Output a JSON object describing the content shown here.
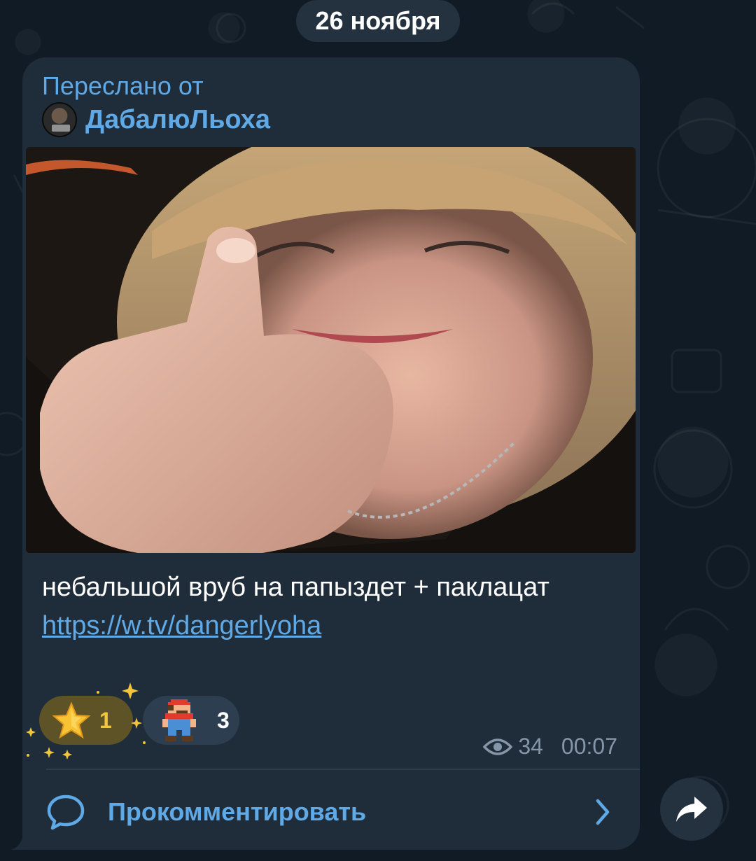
{
  "date_separator": "26 ноября",
  "message": {
    "forwarded_label": "Переслано от",
    "forwarded_author": "ДабалюЛьоха",
    "caption_text": "небальшой вруб на папыздет + паклацат",
    "caption_link": "https://w.tv/dangerlyoha",
    "reactions": [
      {
        "emoji": "star-icon",
        "count": "1"
      },
      {
        "emoji": "mario-icon",
        "count": "3"
      }
    ],
    "views": "34",
    "time": "00:07"
  },
  "comments": {
    "label": "Прокомментировать"
  },
  "colors": {
    "accent": "#5fa9e6",
    "bubble": "#1f2c39",
    "background": "#101b25",
    "star_reaction": "#5e5227",
    "meta_text": "#8596a8"
  }
}
